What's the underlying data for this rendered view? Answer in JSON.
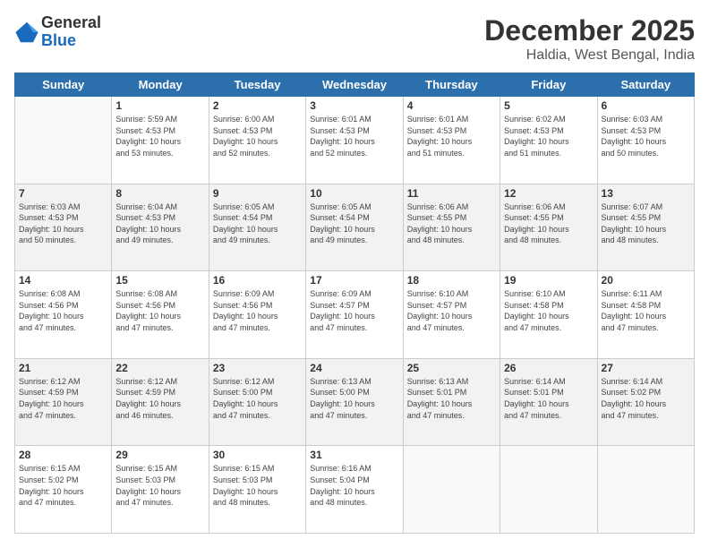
{
  "logo": {
    "general": "General",
    "blue": "Blue"
  },
  "header": {
    "month": "December 2025",
    "location": "Haldia, West Bengal, India"
  },
  "weekdays": [
    "Sunday",
    "Monday",
    "Tuesday",
    "Wednesday",
    "Thursday",
    "Friday",
    "Saturday"
  ],
  "weeks": [
    [
      {
        "day": "",
        "info": ""
      },
      {
        "day": "1",
        "info": "Sunrise: 5:59 AM\nSunset: 4:53 PM\nDaylight: 10 hours\nand 53 minutes."
      },
      {
        "day": "2",
        "info": "Sunrise: 6:00 AM\nSunset: 4:53 PM\nDaylight: 10 hours\nand 52 minutes."
      },
      {
        "day": "3",
        "info": "Sunrise: 6:01 AM\nSunset: 4:53 PM\nDaylight: 10 hours\nand 52 minutes."
      },
      {
        "day": "4",
        "info": "Sunrise: 6:01 AM\nSunset: 4:53 PM\nDaylight: 10 hours\nand 51 minutes."
      },
      {
        "day": "5",
        "info": "Sunrise: 6:02 AM\nSunset: 4:53 PM\nDaylight: 10 hours\nand 51 minutes."
      },
      {
        "day": "6",
        "info": "Sunrise: 6:03 AM\nSunset: 4:53 PM\nDaylight: 10 hours\nand 50 minutes."
      }
    ],
    [
      {
        "day": "7",
        "info": "Sunrise: 6:03 AM\nSunset: 4:53 PM\nDaylight: 10 hours\nand 50 minutes."
      },
      {
        "day": "8",
        "info": "Sunrise: 6:04 AM\nSunset: 4:53 PM\nDaylight: 10 hours\nand 49 minutes."
      },
      {
        "day": "9",
        "info": "Sunrise: 6:05 AM\nSunset: 4:54 PM\nDaylight: 10 hours\nand 49 minutes."
      },
      {
        "day": "10",
        "info": "Sunrise: 6:05 AM\nSunset: 4:54 PM\nDaylight: 10 hours\nand 49 minutes."
      },
      {
        "day": "11",
        "info": "Sunrise: 6:06 AM\nSunset: 4:55 PM\nDaylight: 10 hours\nand 48 minutes."
      },
      {
        "day": "12",
        "info": "Sunrise: 6:06 AM\nSunset: 4:55 PM\nDaylight: 10 hours\nand 48 minutes."
      },
      {
        "day": "13",
        "info": "Sunrise: 6:07 AM\nSunset: 4:55 PM\nDaylight: 10 hours\nand 48 minutes."
      }
    ],
    [
      {
        "day": "14",
        "info": "Sunrise: 6:08 AM\nSunset: 4:56 PM\nDaylight: 10 hours\nand 47 minutes."
      },
      {
        "day": "15",
        "info": "Sunrise: 6:08 AM\nSunset: 4:56 PM\nDaylight: 10 hours\nand 47 minutes."
      },
      {
        "day": "16",
        "info": "Sunrise: 6:09 AM\nSunset: 4:56 PM\nDaylight: 10 hours\nand 47 minutes."
      },
      {
        "day": "17",
        "info": "Sunrise: 6:09 AM\nSunset: 4:57 PM\nDaylight: 10 hours\nand 47 minutes."
      },
      {
        "day": "18",
        "info": "Sunrise: 6:10 AM\nSunset: 4:57 PM\nDaylight: 10 hours\nand 47 minutes."
      },
      {
        "day": "19",
        "info": "Sunrise: 6:10 AM\nSunset: 4:58 PM\nDaylight: 10 hours\nand 47 minutes."
      },
      {
        "day": "20",
        "info": "Sunrise: 6:11 AM\nSunset: 4:58 PM\nDaylight: 10 hours\nand 47 minutes."
      }
    ],
    [
      {
        "day": "21",
        "info": "Sunrise: 6:12 AM\nSunset: 4:59 PM\nDaylight: 10 hours\nand 47 minutes."
      },
      {
        "day": "22",
        "info": "Sunrise: 6:12 AM\nSunset: 4:59 PM\nDaylight: 10 hours\nand 46 minutes."
      },
      {
        "day": "23",
        "info": "Sunrise: 6:12 AM\nSunset: 5:00 PM\nDaylight: 10 hours\nand 47 minutes."
      },
      {
        "day": "24",
        "info": "Sunrise: 6:13 AM\nSunset: 5:00 PM\nDaylight: 10 hours\nand 47 minutes."
      },
      {
        "day": "25",
        "info": "Sunrise: 6:13 AM\nSunset: 5:01 PM\nDaylight: 10 hours\nand 47 minutes."
      },
      {
        "day": "26",
        "info": "Sunrise: 6:14 AM\nSunset: 5:01 PM\nDaylight: 10 hours\nand 47 minutes."
      },
      {
        "day": "27",
        "info": "Sunrise: 6:14 AM\nSunset: 5:02 PM\nDaylight: 10 hours\nand 47 minutes."
      }
    ],
    [
      {
        "day": "28",
        "info": "Sunrise: 6:15 AM\nSunset: 5:02 PM\nDaylight: 10 hours\nand 47 minutes."
      },
      {
        "day": "29",
        "info": "Sunrise: 6:15 AM\nSunset: 5:03 PM\nDaylight: 10 hours\nand 47 minutes."
      },
      {
        "day": "30",
        "info": "Sunrise: 6:15 AM\nSunset: 5:03 PM\nDaylight: 10 hours\nand 48 minutes."
      },
      {
        "day": "31",
        "info": "Sunrise: 6:16 AM\nSunset: 5:04 PM\nDaylight: 10 hours\nand 48 minutes."
      },
      {
        "day": "",
        "info": ""
      },
      {
        "day": "",
        "info": ""
      },
      {
        "day": "",
        "info": ""
      }
    ]
  ]
}
